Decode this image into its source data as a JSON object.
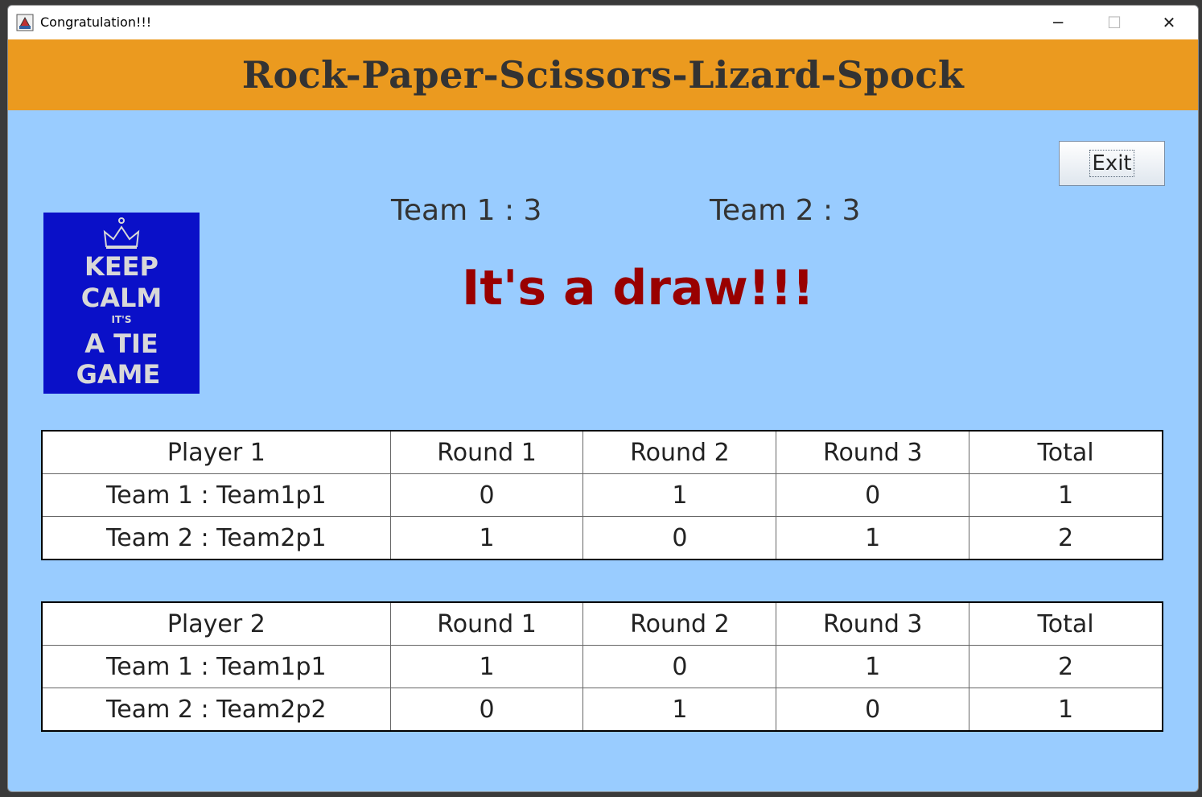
{
  "window": {
    "title": "Congratulation!!!",
    "min_glyph": "─",
    "max_glyph": "☐",
    "close_glyph": "✕"
  },
  "banner": {
    "title": "Rock-Paper-Scissors-Lizard-Spock",
    "color": "#eb9a1f"
  },
  "exit_button": {
    "label": "Exit"
  },
  "image": {
    "lines": [
      "KEEP",
      "CALM",
      "IT'S",
      "A TIE",
      "GAME"
    ],
    "background": "#0a10c8"
  },
  "scores": {
    "team1": "Team 1 : 3",
    "team2": "Team 2 : 3"
  },
  "result": {
    "text": "It's a draw!!!",
    "color": "#990000"
  },
  "tables": [
    {
      "headers": [
        "Player 1",
        "Round 1",
        "Round 2",
        "Round 3",
        "Total"
      ],
      "rows": [
        [
          "Team 1 : Team1p1",
          "0",
          "1",
          "0",
          "1"
        ],
        [
          "Team 2 : Team2p1",
          "1",
          "0",
          "1",
          "2"
        ]
      ]
    },
    {
      "headers": [
        "Player 2",
        "Round 1",
        "Round 2",
        "Round 3",
        "Total"
      ],
      "rows": [
        [
          "Team 1 : Team1p1",
          "1",
          "0",
          "1",
          "2"
        ],
        [
          "Team 2 : Team2p2",
          "0",
          "1",
          "0",
          "1"
        ]
      ]
    }
  ]
}
